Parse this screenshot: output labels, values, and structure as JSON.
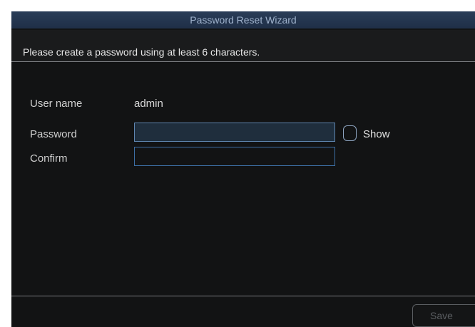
{
  "window": {
    "title": "Password Reset Wizard",
    "instruction": "Please create a password using at least 6 characters."
  },
  "form": {
    "username_label": "User name",
    "username_value": "admin",
    "password_label": "Password",
    "password_value": "",
    "confirm_label": "Confirm",
    "confirm_value": "",
    "show_label": "Show",
    "show_checked": false
  },
  "footer": {
    "save_label": "Save",
    "save_enabled": false
  },
  "colors": {
    "background": "#121314",
    "title_bar": "#22344e",
    "field_border": "#3d6fa4",
    "active_field": "#1f2e3d"
  }
}
